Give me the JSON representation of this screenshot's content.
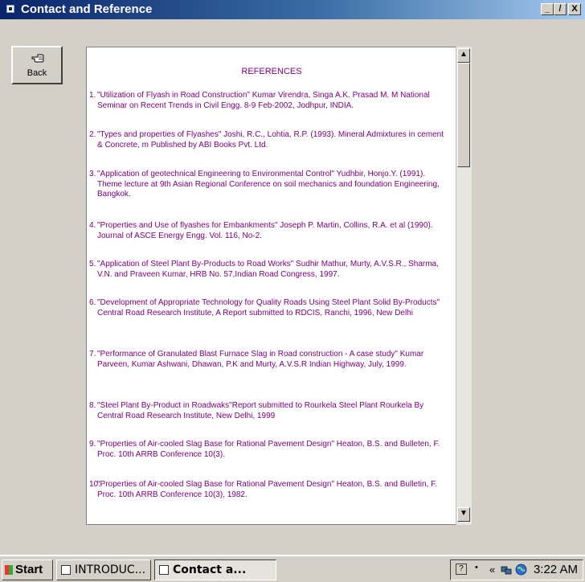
{
  "window": {
    "title": "Contact and Reference",
    "controls": {
      "minimize": "_",
      "maximize": "̸",
      "close": "X"
    }
  },
  "back_button": {
    "label": "Back",
    "icon": "hand-pointing-icon"
  },
  "references": {
    "heading": "REFERENCES",
    "items": [
      {
        "num": "1.",
        "text": "\"Utilization of Flyash in Road Construction\" Kumar Virendra, Singa A.K. Prasad M. M National Seminar on Recent Trends in Civil Engg. 8-9 Feb-2002, Jodhpur, INDIA."
      },
      {
        "num": "2.",
        "text": "\"Types and properties of Flyashes\" Joshi, R.C., Lohtia, R.P. (1993). Mineral Admixtures in cement & Concrete, m Published by ABI Books Pvt. Ltd."
      },
      {
        "num": "3.",
        "text": "\"Application of geotechnical Engineering to Environmental Control\" Yudhbir, Honjo.Y. (1991). Theme lecture at 9th Asian Regional Conference on soil mechanics and foundation Engineering, Bangkok."
      },
      {
        "num": "4.",
        "text": "\"Properties and Use of flyashes for Embankments\" Joseph P. Martin, Collins, R.A. et al (1990). Journal of ASCE Energy Engg. Vol. 116, No-2."
      },
      {
        "num": "5.",
        "text": "\"Application of Steel Plant By-Products to Road Works\" Sudhir Mathur, Murty, A.V.S.R., Sharma, V.N. and Praveen Kumar, HRB No. 57,Indian Road Congress, 1997."
      },
      {
        "num": "6.",
        "text": "\"Development of Appropriate Technology for Quality Roads Using Steel Plant Solid By-Products\" Central Road Research Institute, A Report submitted to RDCIS, Ranchi, 1996, New Delhi"
      },
      {
        "num": "7.",
        "text": "\"Performance of Granulated Blast Furnace Slag in Road construction - A case study\" Kumar Parveen, Kumar Ashwani, Dhawan, P.K and Murty, A.V.S.R Indian Highway, July, 1999."
      },
      {
        "num": "8.",
        "text": "\"Steel Plant By-Product in Roadwaks\"Report submitted to Rourkela Steel Plant Rourkela By Central Road Research Institute, New Delhi, 1999"
      },
      {
        "num": "9.",
        "text": "\"Properties of Air-cooled Slag Base for Rational Pavement Design\" Heaton, B.S. and Bulleten, F. Proc. 10th ARRB Conference 10(3)."
      },
      {
        "num": "10.",
        "text": "\"Properties of Air-cooled Slag Base for Rational Pavement Design\" Heaton, B.S. and Bulletin, F. Proc. 10th ARRB Conference 10(3), 1982."
      }
    ]
  },
  "scrollbar": {
    "up": "▲",
    "down": "▼"
  },
  "taskbar": {
    "start": "Start",
    "tasks": [
      {
        "label": "INTRODUC...",
        "active": false
      },
      {
        "label": "Contact a...",
        "active": true
      }
    ],
    "tray": {
      "help": "?",
      "arrows": "«",
      "clock": "3:22 AM"
    }
  },
  "colors": {
    "title_bar": "#0a246a",
    "reference_text": "#800080",
    "face": "#d4d0c8"
  }
}
